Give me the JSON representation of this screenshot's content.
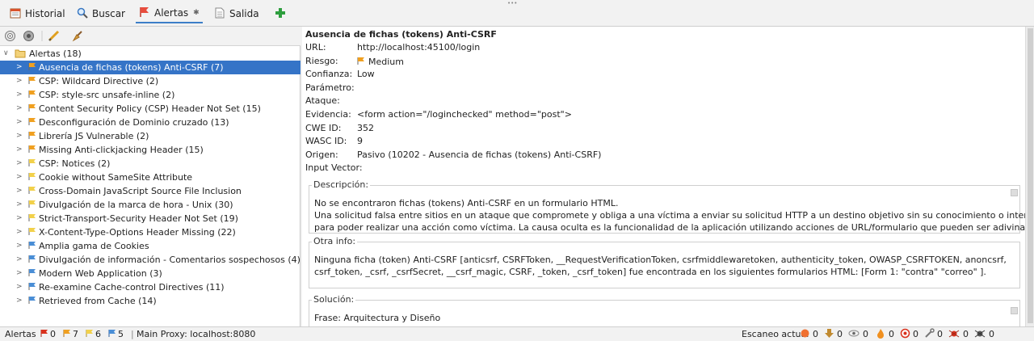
{
  "tabs": [
    {
      "label": "Historial",
      "icon": "calendar-icon"
    },
    {
      "label": "Buscar",
      "icon": "magnifier-icon"
    },
    {
      "label": "Alertas",
      "icon": "flag-icon",
      "pin": "📌"
    },
    {
      "label": "Salida",
      "icon": "document-icon"
    }
  ],
  "tree": {
    "root": "Alertas (18)",
    "items": [
      {
        "label": "Ausencia de fichas (tokens) Anti-CSRF (7)",
        "risk": "medium"
      },
      {
        "label": "CSP: Wildcard Directive (2)",
        "risk": "medium"
      },
      {
        "label": "CSP: style-src unsafe-inline (2)",
        "risk": "medium"
      },
      {
        "label": "Content Security Policy (CSP) Header Not Set (15)",
        "risk": "medium"
      },
      {
        "label": "Desconfiguración de Dominio cruzado (13)",
        "risk": "medium"
      },
      {
        "label": "Librería JS Vulnerable (2)",
        "risk": "medium"
      },
      {
        "label": "Missing Anti-clickjacking Header (15)",
        "risk": "medium"
      },
      {
        "label": "CSP: Notices (2)",
        "risk": "low"
      },
      {
        "label": "Cookie without SameSite Attribute",
        "risk": "low"
      },
      {
        "label": "Cross-Domain JavaScript Source File Inclusion",
        "risk": "low"
      },
      {
        "label": "Divulgación de la marca de hora - Unix (30)",
        "risk": "low"
      },
      {
        "label": "Strict-Transport-Security Header Not Set (19)",
        "risk": "low"
      },
      {
        "label": "X-Content-Type-Options Header Missing (22)",
        "risk": "low"
      },
      {
        "label": "Amplia gama de Cookies",
        "risk": "info"
      },
      {
        "label": "Divulgación de información - Comentarios sospechosos (4)",
        "risk": "info"
      },
      {
        "label": "Modern Web Application (3)",
        "risk": "info"
      },
      {
        "label": "Re-examine Cache-control Directives (11)",
        "risk": "info"
      },
      {
        "label": "Retrieved from Cache (14)",
        "risk": "info"
      }
    ]
  },
  "detail": {
    "title": "Ausencia de fichas (tokens) Anti-CSRF",
    "fields": [
      {
        "k": "URL:",
        "v": "http://localhost:45100/login"
      },
      {
        "k": "Riesgo:",
        "v": "Medium"
      },
      {
        "k": "Confianza:",
        "v": "Low"
      },
      {
        "k": "Parámetro:",
        "v": ""
      },
      {
        "k": "Ataque:",
        "v": ""
      },
      {
        "k": "Evidencia:",
        "v": "<form action=\"/loginchecked\" method=\"post\">"
      },
      {
        "k": "CWE ID:",
        "v": "352"
      },
      {
        "k": "WASC ID:",
        "v": "9"
      },
      {
        "k": "Origen:",
        "v": "Pasivo (10202 - Ausencia de fichas (tokens) Anti-CSRF)"
      },
      {
        "k": "Input Vector:",
        "v": ""
      }
    ],
    "desc_legend": "Descripción:",
    "desc_lines": [
      "No se encontraron fichas (tokens) Anti-CSRF en un formulario HTML.",
      "Una solicitud falsa entre sitios en un ataque que compromete y obliga a una víctima a enviar su solicitud HTTP a un destino objetivo sin su conocimiento o intención",
      "para poder realizar una acción como víctima. La causa oculta es la funcionalidad de la aplicación utilizando acciones de URL/formulario que pueden ser adivinados de"
    ],
    "other_legend": "Otra info:",
    "other_lines": [
      "Ninguna ficha (token) Anti-CSRF [anticsrf, CSRFToken, __RequestVerificationToken, csrfmiddlewaretoken, authenticity_token, OWASP_CSRFTOKEN, anoncsrf,",
      "csrf_token, _csrf, _csrfSecret, __csrf_magic, CSRF, _token, _csrf_token] fue encontrada en los siguientes formularios HTML: [Form 1: \"contra\" \"correo\" ]."
    ],
    "sol_legend": "Solución:",
    "sol_lines": [
      "Frase: Arquitectura y Diseño"
    ]
  },
  "status": {
    "alerts_label": "Alertas",
    "counts": [
      "0",
      "7",
      "6",
      "5"
    ],
    "proxy": "Main Proxy: localhost:8080",
    "scan_label": "Escaneo actual",
    "scan_counts": [
      "0",
      "0",
      "0",
      "0",
      "0",
      "0",
      "0",
      "0"
    ]
  },
  "colors": {
    "high": "#d9301c",
    "medium": "#f0a020",
    "low": "#f2d14a",
    "info": "#4a8ed6",
    "selection": "#3574c7"
  }
}
